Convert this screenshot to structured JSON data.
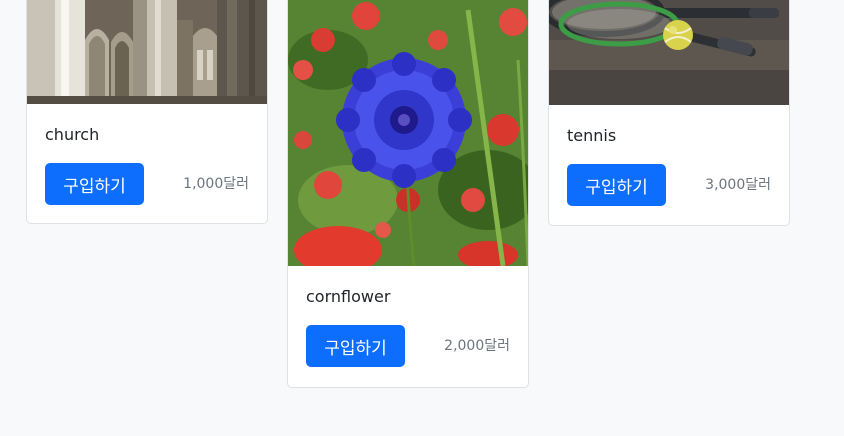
{
  "products": [
    {
      "name": "church",
      "buy_label": "구입하기",
      "price": "1,000달러",
      "image": "church-photo"
    },
    {
      "name": "cornflower",
      "buy_label": "구입하기",
      "price": "2,000달러",
      "image": "cornflower-photo"
    },
    {
      "name": "tennis",
      "buy_label": "구입하기",
      "price": "3,000달러",
      "image": "tennis-photo"
    }
  ],
  "colors": {
    "page_bg": "#f8f9fa",
    "button_bg": "#0d6efd",
    "price_text": "#6c757d",
    "title_text": "#212529"
  }
}
